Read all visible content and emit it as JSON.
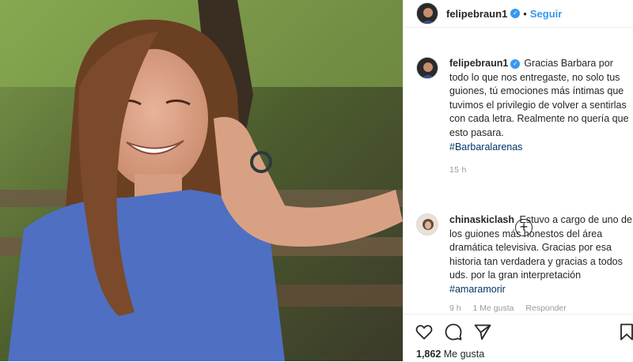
{
  "post": {
    "username": "felipebraun1",
    "follow_label": "Seguir",
    "dot": "•",
    "caption_text": "Gracias Barbara por todo lo que nos entregaste, no solo tus guiones, tú emociones más íntimas que tuvimos el privilegio de volver a sentirlas con cada letra. Realmente no quería que esto pasara.",
    "caption_hashtag": "#Barbaralarenas",
    "caption_time": "15 h",
    "likes_count": "1,862",
    "likes_label": "Me gusta"
  },
  "comments": [
    {
      "username": "chinaskiclash",
      "text": "Estuvo a cargo de uno de los guiones más honestos del área dramática televisiva. Gracias por esa historia tan verdadera y gracias a todos uds. por la gran interpretación",
      "hashtag": "#amaramorir",
      "time": "9 h",
      "likes": "1 Me gusta",
      "reply": "Responder"
    }
  ],
  "icons": {
    "verified": "verified-badge-icon",
    "load_more": "plus-circle-icon",
    "like": "heart-icon",
    "comment": "comment-icon",
    "share": "share-icon",
    "save": "bookmark-icon"
  },
  "colors": {
    "link_blue": "#3897f0",
    "hashtag_blue": "#003569",
    "muted_gray": "#999999",
    "text": "#262626",
    "border": "#efefef"
  }
}
